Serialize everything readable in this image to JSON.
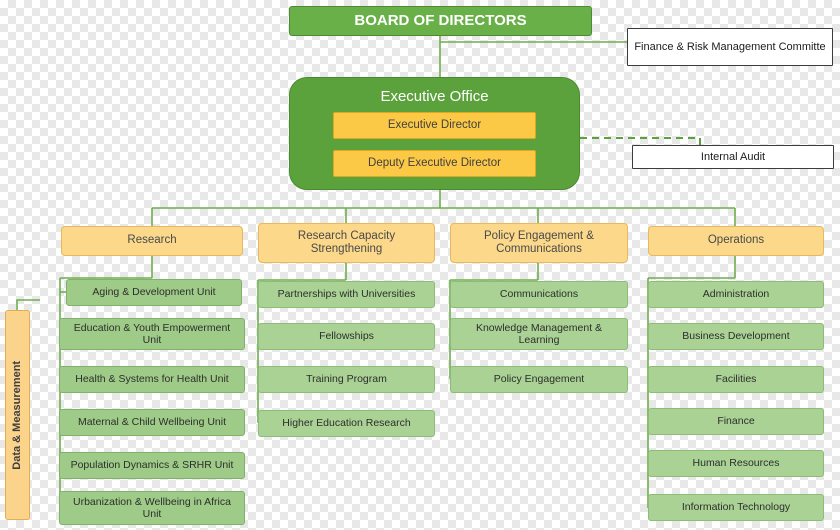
{
  "diagram": {
    "title": "Organizational Chart",
    "colors": {
      "board_fill": "#69b048",
      "exec_fill": "#5ca23c",
      "amber_fill": "#fcc947",
      "cream_fill": "#fbd88a",
      "green_fill": "#9ecb87",
      "connector": "#6fae4f"
    },
    "board": {
      "label": "BOARD OF DIRECTORS"
    },
    "committee": {
      "label": "Finance & Risk Management Committe"
    },
    "internal_audit": {
      "label": "Internal Audit"
    },
    "executive_office": {
      "label": "Executive Office",
      "roles": [
        {
          "label": "Executive Director"
        },
        {
          "label": "Deputy Executive Director"
        }
      ]
    },
    "side_unit": {
      "label": "Data & Measurement"
    },
    "departments": [
      {
        "label": "Research",
        "units": [
          {
            "label": "Aging & Development Unit"
          },
          {
            "label": "Education & Youth Empowerment Unit"
          },
          {
            "label": "Health & Systems for Health Unit"
          },
          {
            "label": "Maternal & Child Wellbeing Unit"
          },
          {
            "label": "Population Dynamics & SRHR Unit"
          },
          {
            "label": "Urbanization & Wellbeing in Africa Unit"
          }
        ]
      },
      {
        "label": "Research Capacity Strengthening",
        "units": [
          {
            "label": "Partnerships with Universities"
          },
          {
            "label": "Fellowships"
          },
          {
            "label": "Training Program"
          },
          {
            "label": "Higher Education Research"
          }
        ]
      },
      {
        "label": "Policy Engagement & Communications",
        "units": [
          {
            "label": "Communications"
          },
          {
            "label": "Knowledge Management & Learning"
          },
          {
            "label": "Policy Engagement"
          }
        ]
      },
      {
        "label": "Operations",
        "units": [
          {
            "label": "Administration"
          },
          {
            "label": "Business Development"
          },
          {
            "label": "Facilities"
          },
          {
            "label": "Finance"
          },
          {
            "label": "Human Resources"
          },
          {
            "label": "Information Technology"
          }
        ]
      }
    ]
  }
}
